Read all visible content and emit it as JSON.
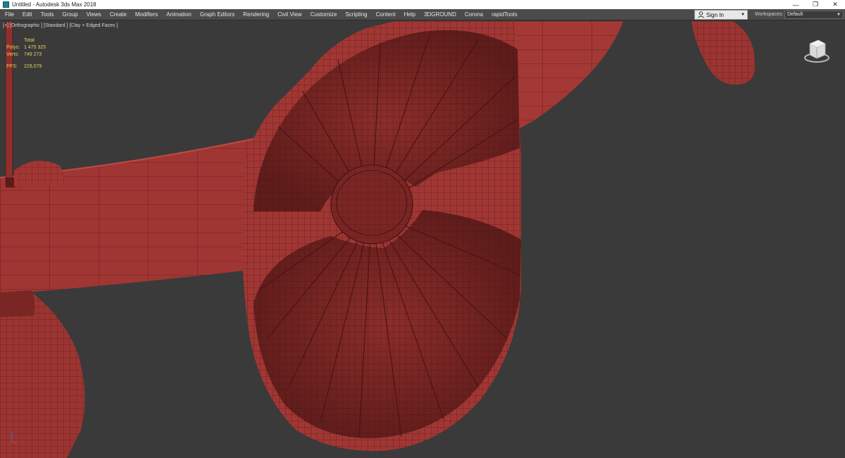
{
  "window": {
    "title": "Untitled - Autodesk 3ds Max 2018",
    "minimize_glyph": "—",
    "restore_glyph": "❐",
    "close_glyph": "✕"
  },
  "menu": {
    "items": [
      "File",
      "Edit",
      "Tools",
      "Group",
      "Views",
      "Create",
      "Modifiers",
      "Animation",
      "Graph Editors",
      "Rendering",
      "Civil View",
      "Customize",
      "Scripting",
      "Content",
      "Help",
      "3DGROUND",
      "Corona",
      "rapidTools"
    ]
  },
  "account": {
    "sign_in_label": "Sign In",
    "workspaces_label": "Workspaces:",
    "workspace_value": "Default"
  },
  "viewport": {
    "label": "[+] [Orthographic ] [Standard ] [Clay + Edged Faces ]",
    "stats": {
      "total_label": "Total",
      "polys_label": "Polys:",
      "polys_value": "1 475 325",
      "verts_label": "Verts:",
      "verts_value": "749 273",
      "fps_label": "FPS:",
      "fps_value": "229,079"
    }
  },
  "colors": {
    "viewport_bg": "#3a3a3a",
    "model_fill": "#9b3532",
    "model_dark": "#6e2220",
    "wire": "#3b0f0e",
    "stats_text": "#e2d35a",
    "menubar_bg": "#4b4b4b"
  },
  "icons": {
    "app": "3ds-max-icon",
    "user": "user-icon",
    "viewcube": "viewcube-icon",
    "axis": "axis-tripod-icon"
  }
}
